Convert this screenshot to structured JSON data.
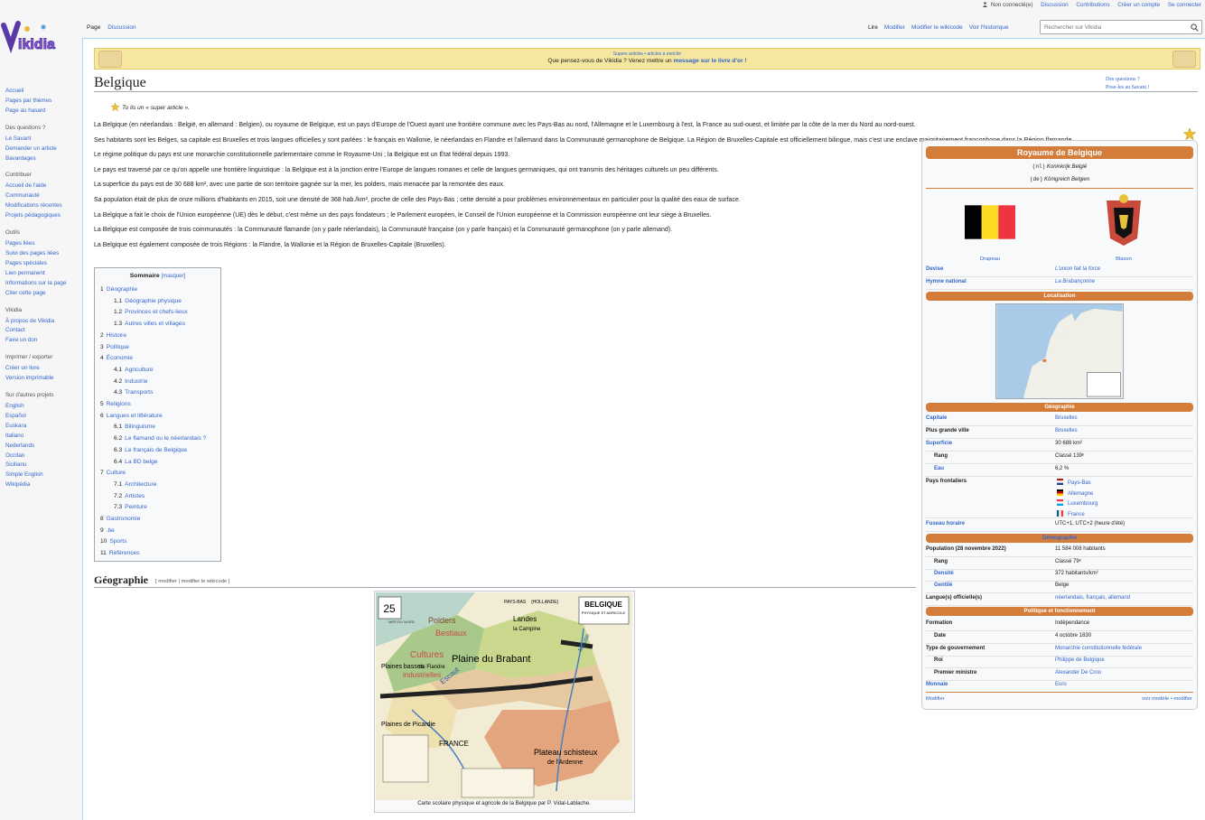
{
  "personal": {
    "not_logged": "Non connecté(e)",
    "discussion": "Discussion",
    "contributions": "Contributions",
    "create_account": "Créer un compte",
    "login": "Se connecter"
  },
  "logo": {
    "text": "Vikidia"
  },
  "tabs": {
    "page": "Page",
    "discussion": "Discussion",
    "read": "Lire",
    "edit": "Modifier",
    "edit_source": "Modifier le wikicode",
    "history": "Voir l'historique"
  },
  "search": {
    "placeholder": "Rechercher sur Vikidia"
  },
  "sidebar": {
    "nav": [
      "Accueil",
      "Pages par thèmes",
      "Page au hasard"
    ],
    "questions": {
      "title": "Des questions ?",
      "items": [
        "Le Savant",
        "Demander un article",
        "Bavardages"
      ]
    },
    "contribute": {
      "title": "Contribuer",
      "items": [
        "Accueil de l'aide",
        "Communauté",
        "Modifications récentes",
        "Projets pédagogiques"
      ]
    },
    "tools": {
      "title": "Outils",
      "items": [
        "Pages liées",
        "Suivi des pages liées",
        "Pages spéciales",
        "Lien permanent",
        "Informations sur la page",
        "Citer cette page"
      ]
    },
    "vikidia": {
      "title": "Vikidia",
      "items": [
        "À propos de Vikidia",
        "Contact",
        "Faire un don"
      ]
    },
    "print": {
      "title": "Imprimer / exporter",
      "items": [
        "Créer un livre",
        "Version imprimable"
      ]
    },
    "other": {
      "title": "Sur d'autres projets",
      "items": [
        "English",
        "Español",
        "Euskara",
        "Italiano",
        "Nederlands",
        "Occitan",
        "Sicilianu",
        "Simple English",
        "Wikipédia"
      ]
    }
  },
  "banner": {
    "top": "Supers articles • articles à enrichir",
    "message": "Que pensez-vous de Vikidia ? Venez mettre un ",
    "link": "message sur le livre d'or !"
  },
  "article": {
    "title": "Belgique",
    "help_q": "Des questions ?",
    "help_s": "Pose-les au Savant !",
    "super": "Tu lis un « super article ».",
    "paragraphs": [
      "La Belgique (en néerlandais : België, en allemand : Belgien), ou royaume de Belgique, est un pays d'Europe de l'Ouest ayant une frontière commune avec les Pays-Bas au nord, l'Allemagne et le Luxembourg à l'est, la France au sud-ouest, et limitée par la côte de la mer du Nord au nord-ouest.",
      "Ses habitants sont les Belges, sa capitale est Bruxelles et trois langues officielles y sont parlées : le français en Wallonie, le néerlandais en Flandre et l'allemand dans la Communauté germanophone de Belgique. La Région de Bruxelles-Capitale est officiellement bilingue, mais c'est une enclave majoritairement francophone dans la Région flamande.",
      "Le régime politique du pays est une monarchie constitutionnelle parlementaire comme le Royaume-Uni ; la Belgique est un État fédéral depuis 1993.",
      "Le pays est traversé par ce qu'on appelle une frontière linguistique : la Belgique est à la jonction entre l'Europe de langues romanes et celle de langues germaniques, qui ont transmis des héritages culturels un peu différents.",
      "La superficie du pays est de 30 688 km², avec une partie de son territoire gagnée sur la mer, les polders, mais menacée par la remontée des eaux.",
      "Sa population était de plus de onze millions d'habitants en 2015, soit une densité de 368 hab./km², proche de celle des Pays-Bas ; cette densité a pour problèmes environnementaux en particulier pour la qualité des eaux de surface.",
      "La Belgique a fait le choix de l'Union européenne (UE) dès le début, c'est même un des pays fondateurs ; le Parlement européen, le Conseil de l'Union européenne et la Commission européenne ont leur siège à Bruxelles.",
      "La Belgique est composée de trois communautés : la Communauté flamande (on y parle néerlandais), la Communauté française (on y parle français) et la Communauté germanophone (on y parle allemand).",
      "La Belgique est également composée de trois Régions : la Flandre, la Wallonie et la Région de Bruxelles-Capitale (Bruxelles)."
    ],
    "geo_heading": "Géographie",
    "geo_edit": "[ modifier | modifier le wikicode ]",
    "caption": "Carte scolaire physique et agricole de la Belgique par P. Vidal-Lablache."
  },
  "toc": {
    "title": "Sommaire",
    "toggle": "[masquer]",
    "items": [
      {
        "n": "1",
        "t": "Géographie",
        "l": 1
      },
      {
        "n": "1.1",
        "t": "Géographie physique",
        "l": 2
      },
      {
        "n": "1.2",
        "t": "Provinces et chefs-lieux",
        "l": 2
      },
      {
        "n": "1.3",
        "t": "Autres villes et villages",
        "l": 2
      },
      {
        "n": "2",
        "t": "Histoire",
        "l": 1
      },
      {
        "n": "3",
        "t": "Politique",
        "l": 1
      },
      {
        "n": "4",
        "t": "Économie",
        "l": 1
      },
      {
        "n": "4.1",
        "t": "Agriculture",
        "l": 2
      },
      {
        "n": "4.2",
        "t": "Industrie",
        "l": 2
      },
      {
        "n": "4.3",
        "t": "Transports",
        "l": 2
      },
      {
        "n": "5",
        "t": "Religions",
        "l": 1
      },
      {
        "n": "6",
        "t": "Langues et littérature",
        "l": 1
      },
      {
        "n": "6.1",
        "t": "Bilinguisme",
        "l": 2
      },
      {
        "n": "6.2",
        "t": "Le flamand ou le néerlandais ?",
        "l": 2
      },
      {
        "n": "6.3",
        "t": "Le français de Belgique",
        "l": 2
      },
      {
        "n": "6.4",
        "t": "La BD belge",
        "l": 2
      },
      {
        "n": "7",
        "t": "Culture",
        "l": 1
      },
      {
        "n": "7.1",
        "t": "Architecture",
        "l": 2
      },
      {
        "n": "7.2",
        "t": "Artistes",
        "l": 2
      },
      {
        "n": "7.3",
        "t": "Peinture",
        "l": 2
      },
      {
        "n": "8",
        "t": "Gastronomie",
        "l": 1
      },
      {
        "n": "9",
        "t": ".be",
        "l": 1
      },
      {
        "n": "10",
        "t": "Sports",
        "l": 1
      },
      {
        "n": "11",
        "t": "Références",
        "l": 1
      }
    ]
  },
  "map_labels": {
    "pb": "PAYS-BAS",
    "holl": "(HOLLANDE)",
    "title": "BELGIQUE",
    "sub": "PHYSIQUE ET AGRICOLE",
    "polders": "Polders",
    "bestiaux": "Bestiaux",
    "landes": "Landes",
    "campine": "la Campine",
    "cultures": "Cultures",
    "plaine": "Plaine du Brabant",
    "plaines": "Plaines basses",
    "flandre": "de Flandre",
    "industrielles": "industrielles",
    "escaut": "Escaut",
    "meuse": "Meuse",
    "france": "FRANCE",
    "plateau": "Plateau schisteux",
    "ardenne": "de l'Ardenne",
    "picardie": "Plaines de Picardie",
    "number": "25",
    "mer": "MER DU NORD"
  },
  "infobox": {
    "title": "Royaume de Belgique",
    "nl_tag": "(nl)",
    "nl_name": "Koninkrijk België",
    "de_tag": "(de)",
    "de_name": "Königreich Belgien",
    "flag_cap": "Drapeau",
    "coa_cap": "Blason",
    "h_loc": "Localisation",
    "h_geo": "Géographie",
    "h_demo": "Démographie",
    "h_pol": "Politique et fonctionnement",
    "devise_l": "Devise",
    "devise_v": "L'union fait la force",
    "hymne_l": "Hymne national",
    "hymne_v": "La Brabançonne",
    "capitale_l": "Capitale",
    "capitale_v": "Bruxelles",
    "ville_l": "Plus grande ville",
    "ville_v": "Bruxelles",
    "sup_l": "Superficie",
    "sup_v": "30 688 km²",
    "rang_l": "Rang",
    "rang_v": "Classé 139ᵉ",
    "eau_l": "Eau",
    "eau_v": "6,2 %",
    "pays_l": "Pays frontaliers",
    "pays": [
      "Pays-Bas",
      "Allemagne",
      "Luxembourg",
      "France"
    ],
    "fuseau_l": "Fuseau horaire",
    "fuseau_v": "UTC+1, UTC+2 (heure d'été)",
    "pop_l": "Population (28 novembre 2022)",
    "pop_v": "11 584 008 habitants",
    "rang2_l": "Rang",
    "rang2_v": "Classé 79ᵉ",
    "dens_l": "Densité",
    "dens_v": "372 habitants/km²",
    "gent_l": "Gentilé",
    "gent_v": "Belge",
    "lang_l": "Langue(s) officielle(s)",
    "lang_v": "néerlandais, français, allemand",
    "form_l": "Formation",
    "form_v": "Indépendance",
    "date_l": "Date",
    "date_v": "4 octobre 1830",
    "gouv_l": "Type de gouvernement",
    "gouv_v": "Monarchie constitutionnelle fédérale",
    "roi_l": "Roi",
    "roi_v": "Philippe de Belgique",
    "pm_l": "Premier ministre",
    "pm_v": "Alexander De Croo",
    "mon_l": "Monnaie",
    "mon_v": "Euro",
    "modifier": "Modifier",
    "voir": "voir modèle • modifier"
  },
  "colors": {
    "accent": "#d47d3a",
    "link": "#3366cc",
    "banner": "#f6e7a0"
  }
}
